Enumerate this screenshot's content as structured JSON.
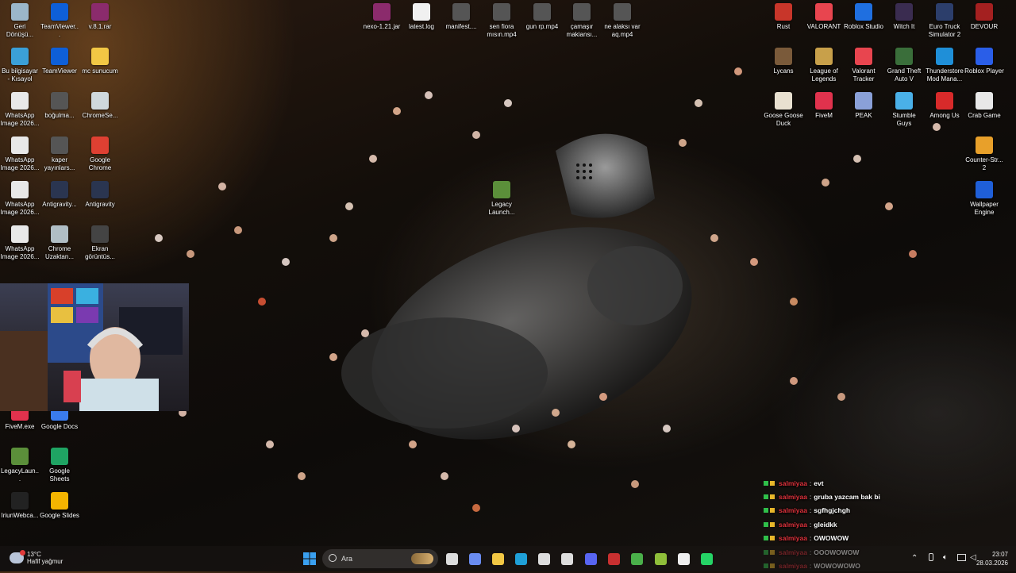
{
  "desktop": {
    "left_icons": [
      {
        "label": "Geri Dönüşü...",
        "icon": "recycle-bin-icon",
        "color": "#9bb6c9"
      },
      {
        "label": "TeamViewer...",
        "icon": "teamviewer-icon",
        "color": "#0e5fd8"
      },
      {
        "label": "v.8.1.rar",
        "icon": "winrar-icon",
        "color": "#8b2b6c"
      },
      {
        "label": "Bu bilgisayar - Kısayol",
        "icon": "computer-icon",
        "color": "#3ba0d8"
      },
      {
        "label": "TeamViewer",
        "icon": "teamviewer-icon",
        "color": "#0e5fd8"
      },
      {
        "label": "mc sunucum",
        "icon": "folder-icon",
        "color": "#f2c744"
      },
      {
        "label": "WhatsApp Image 2026...",
        "icon": "image-file-icon",
        "color": "#e8e8e8"
      },
      {
        "label": "boğulma...",
        "icon": "video-file-icon",
        "color": "#555"
      },
      {
        "label": "ChromeSe...",
        "icon": "chrome-setup-icon",
        "color": "#cfd8dc"
      },
      {
        "label": "WhatsApp Image 2026...",
        "icon": "image-file-icon",
        "color": "#e8e8e8"
      },
      {
        "label": "kaper yayınlars...",
        "icon": "video-file-icon",
        "color": "#555"
      },
      {
        "label": "Google Chrome",
        "icon": "chrome-icon",
        "color": "#de4032"
      },
      {
        "label": "WhatsApp Image 2026...",
        "icon": "image-file-icon",
        "color": "#e8e8e8"
      },
      {
        "label": "Antigravity...",
        "icon": "antigravity-icon",
        "color": "#2a3550"
      },
      {
        "label": "Antigravity",
        "icon": "antigravity-icon",
        "color": "#2a3550"
      },
      {
        "label": "WhatsApp Image 2026...",
        "icon": "image-file-icon",
        "color": "#e8e8e8"
      },
      {
        "label": "Chrome Uzaktan...",
        "icon": "chrome-remote-icon",
        "color": "#b0bec5"
      },
      {
        "label": "Ekran görüntüs...",
        "icon": "screenshot-icon",
        "color": "#444"
      },
      {
        "label": "FiveM.exe",
        "icon": "fivem-icon",
        "color": "#e0324d"
      },
      {
        "label": "Google Docs",
        "icon": "google-docs-icon",
        "color": "#3a7bec"
      },
      {
        "label": "LegacyLaun...",
        "icon": "minecraft-icon",
        "color": "#5b8f3a"
      },
      {
        "label": "Google Sheets",
        "icon": "google-sheets-icon",
        "color": "#1fa463"
      },
      {
        "label": "IriunWebca...",
        "icon": "iriun-webcam-icon",
        "color": "#222"
      },
      {
        "label": "Google Slides",
        "icon": "google-slides-icon",
        "color": "#f4b400"
      }
    ],
    "top_icons": [
      {
        "label": "nexo-1.21.jar",
        "icon": "jar-file-icon",
        "color": "#8b2b6c"
      },
      {
        "label": "latest.log",
        "icon": "log-file-icon",
        "color": "#f0f0f0"
      },
      {
        "label": "manifest....",
        "icon": "file-icon",
        "color": "#555"
      },
      {
        "label": "sen fiora mısın.mp4",
        "icon": "video-file-icon",
        "color": "#555"
      },
      {
        "label": "gun rp.mp4",
        "icon": "video-file-icon",
        "color": "#555"
      },
      {
        "label": "çamaşır makiansı...",
        "icon": "video-file-icon",
        "color": "#555"
      },
      {
        "label": "ne alaksı var aq.mp4",
        "icon": "video-file-icon",
        "color": "#555"
      },
      {
        "label": "Legacy Launch...",
        "icon": "minecraft-icon",
        "color": "#5b8f3a"
      }
    ],
    "right_icons": [
      {
        "label": "Rust",
        "icon": "rust-icon",
        "color": "#c8362a"
      },
      {
        "label": "VALORANT",
        "icon": "valorant-icon",
        "color": "#e8454f"
      },
      {
        "label": "Roblox Studio",
        "icon": "roblox-studio-icon",
        "color": "#1f6fe0"
      },
      {
        "label": "Witch It",
        "icon": "witch-it-icon",
        "color": "#3a2c50"
      },
      {
        "label": "Euro Truck Simulator 2",
        "icon": "ets2-icon",
        "color": "#2c3e6b"
      },
      {
        "label": "DEVOUR",
        "icon": "devour-icon",
        "color": "#a42020"
      },
      {
        "label": "Lycans",
        "icon": "lycans-icon",
        "color": "#7a5a3a"
      },
      {
        "label": "League of Legends",
        "icon": "lol-icon",
        "color": "#c8a04a"
      },
      {
        "label": "Valorant Tracker",
        "icon": "valorant-tracker-icon",
        "color": "#e8454f"
      },
      {
        "label": "Grand Theft Auto V",
        "icon": "gta-icon",
        "color": "#3a6e3a"
      },
      {
        "label": "Thunderstore Mod Mana...",
        "icon": "thunderstore-icon",
        "color": "#1f8fd8"
      },
      {
        "label": "Roblox Player",
        "icon": "roblox-icon",
        "color": "#2a5ee8"
      },
      {
        "label": "Goose Goose Duck",
        "icon": "goose-icon",
        "color": "#e8e0d0"
      },
      {
        "label": "FiveM",
        "icon": "fivem-icon",
        "color": "#e0324d"
      },
      {
        "label": "PEAK",
        "icon": "peak-icon",
        "color": "#8aa0d8"
      },
      {
        "label": "Stumble Guys",
        "icon": "stumble-guys-icon",
        "color": "#4ab0e8"
      },
      {
        "label": "Among Us",
        "icon": "among-us-icon",
        "color": "#d82a2a"
      },
      {
        "label": "Crab Game",
        "icon": "crab-game-icon",
        "color": "#e8e8e8"
      },
      {
        "label": "Counter-Str... 2",
        "icon": "cs2-icon",
        "color": "#e8a02a"
      },
      {
        "label": "Wallpaper Engine",
        "icon": "wallpaper-engine-icon",
        "color": "#1f5fd8"
      }
    ]
  },
  "chat": {
    "lines": [
      {
        "user": "salmiyaa",
        "message": "evt"
      },
      {
        "user": "salmiyaa",
        "message": "gruba yazcam bak bi"
      },
      {
        "user": "salmiyaa",
        "message": "sgfhgjchgh"
      },
      {
        "user": "salmiyaa",
        "message": "gleidkk"
      },
      {
        "user": "salmiyaa",
        "message": "OWOWOW"
      },
      {
        "user": "salmiyaa",
        "message": "OOOWOWOW"
      },
      {
        "user": "salmiyaa",
        "message": "WOWOWOWO"
      }
    ],
    "user_color": "#e0323c"
  },
  "taskbar": {
    "weather_temp": "13°C",
    "weather_desc": "Hafif yağmur",
    "search_placeholder": "Ara",
    "time": "23:07",
    "date": "28.03.2026",
    "apps": [
      {
        "icon": "windows-start-icon",
        "color": "#3aa0f0"
      },
      {
        "icon": "task-view-icon",
        "color": "#ddd"
      },
      {
        "icon": "copilot-icon",
        "color": "#6a8cf0"
      },
      {
        "icon": "file-explorer-icon",
        "color": "#f2c744"
      },
      {
        "icon": "edge-icon",
        "color": "#1fa0d8"
      },
      {
        "icon": "microsoft-store-icon",
        "color": "#ddd"
      },
      {
        "icon": "obs-icon",
        "color": "#ddd"
      },
      {
        "icon": "discord-icon",
        "color": "#5865f2"
      },
      {
        "icon": "app-red-icon",
        "color": "#c83030"
      },
      {
        "icon": "app-green-icon",
        "color": "#4ab04a"
      },
      {
        "icon": "app-file-icon",
        "color": "#8fbf3a"
      },
      {
        "icon": "app-square-icon",
        "color": "#eee"
      },
      {
        "icon": "whatsapp-icon",
        "color": "#25d366"
      }
    ]
  }
}
